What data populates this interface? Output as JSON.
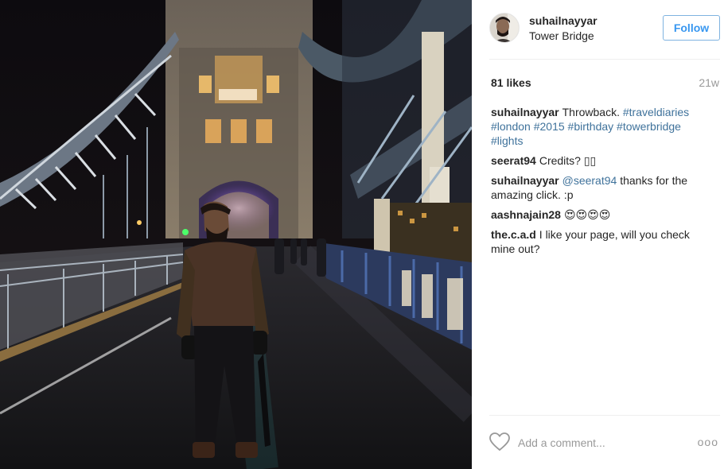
{
  "post": {
    "username": "suhailnayyar",
    "location": "Tower Bridge",
    "follow_label": "Follow",
    "likes": "81 likes",
    "time_ago": "21w",
    "comments": [
      {
        "author": "suhailnayyar",
        "parts": [
          {
            "text": "Throwback. ",
            "tag": false
          },
          {
            "text": "#traveldiaries",
            "tag": true
          },
          {
            "text": " ",
            "tag": false
          },
          {
            "text": "#london",
            "tag": true
          },
          {
            "text": " ",
            "tag": false
          },
          {
            "text": "#2015",
            "tag": true
          },
          {
            "text": " ",
            "tag": false
          },
          {
            "text": "#birthday",
            "tag": true
          },
          {
            "text": " ",
            "tag": false
          },
          {
            "text": "#towerbridge",
            "tag": true
          },
          {
            "text": " ",
            "tag": false
          },
          {
            "text": "#lights",
            "tag": true
          }
        ]
      },
      {
        "author": "seerat94",
        "parts": [
          {
            "text": "Credits? ▯▯",
            "tag": false
          }
        ]
      },
      {
        "author": "suhailnayyar",
        "parts": [
          {
            "text": "@seerat94",
            "tag": true
          },
          {
            "text": " thanks for the amazing click. :p",
            "tag": false
          }
        ]
      },
      {
        "author": "aashnajain28",
        "parts": [
          {
            "text": "😍😍😍😍",
            "tag": false
          }
        ]
      },
      {
        "author": "the.c.a.d",
        "parts": [
          {
            "text": "I like your page, will you check mine out?",
            "tag": false
          }
        ]
      }
    ],
    "add_comment_placeholder": "Add a comment...",
    "more_label": "ooo"
  },
  "icons": {
    "like": "heart-icon",
    "more": "more-options-icon"
  },
  "colors": {
    "link": "#3f729b",
    "follow_text": "#3897f0",
    "muted": "#999999",
    "text": "#262626"
  }
}
